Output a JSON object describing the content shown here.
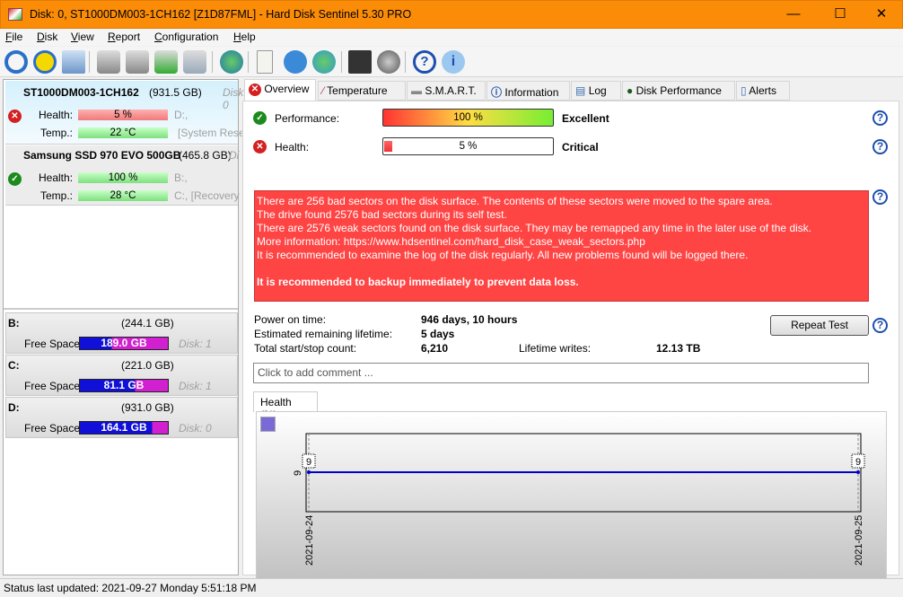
{
  "window": {
    "title": "Disk: 0, ST1000DM003-1CH162 [Z1D87FML]  -  Hard Disk Sentinel 5.30 PRO",
    "minimize": "—",
    "maximize": "☐",
    "close": "✕"
  },
  "menu": [
    "File",
    "Disk",
    "View",
    "Report",
    "Configuration",
    "Help"
  ],
  "toolbar_icons": [
    "refresh-icon",
    "alert-refresh-icon",
    "disk-view-icon",
    "disk-tools-icon",
    "disk-timer-icon",
    "disk-ok-icon",
    "disk-search-icon",
    "web-disk-icon",
    "report-icon",
    "send-report-icon",
    "network-icon",
    "settings-icon",
    "sound-icon",
    "help-icon",
    "info-icon"
  ],
  "disks": [
    {
      "name": "ST1000DM003-1CH162",
      "size": "(931.5 GB)",
      "disk": "Disk: 0",
      "health_label": "Health:",
      "health": "5 %",
      "health_value": 5,
      "temp_label": "Temp.:",
      "temp": "22 °C",
      "vol1": "D:,",
      "vol2": "[System Rese",
      "status": "critical"
    },
    {
      "name": "Samsung SSD 970 EVO 500GB",
      "size": "(465.8 GB)",
      "disk": "Di",
      "health_label": "Health:",
      "health": "100 %",
      "health_value": 100,
      "temp_label": "Temp.:",
      "temp": "28 °C",
      "vol1": "B:,",
      "vol2": "C:,  [Recovery",
      "status": "ok"
    }
  ],
  "volumes": [
    {
      "letter": "B:",
      "size": "(244.1 GB)",
      "free_label": "Free Space",
      "free": "189.0 GB",
      "used_pct": 36,
      "disk": "Disk: 1"
    },
    {
      "letter": "C:",
      "size": "(221.0 GB)",
      "free_label": "Free Space",
      "free": "81.1 GB",
      "used_pct": 63,
      "disk": "Disk: 1"
    },
    {
      "letter": "D:",
      "size": "(931.0 GB)",
      "free_label": "Free Space",
      "free": "164.1 GB",
      "used_pct": 82,
      "disk": "Disk: 0"
    }
  ],
  "tabs": [
    "Overview",
    "Temperature",
    "S.M.A.R.T.",
    "Information",
    "Log",
    "Disk Performance",
    "Alerts"
  ],
  "overview": {
    "performance_label": "Performance:",
    "performance": "100 %",
    "performance_value": 100,
    "performance_rating": "Excellent",
    "health_label": "Health:",
    "health": "5 %",
    "health_value": 5,
    "health_rating": "Critical",
    "message_lines": [
      "There are 256 bad sectors on the disk surface. The contents of these sectors were moved to the spare area.",
      "The drive found 2576 bad sectors during its self test.",
      "There are 2576 weak sectors found on the disk surface. They may be remapped any time in the later use of the disk.",
      "More information: https://www.hdsentinel.com/hard_disk_case_weak_sectors.php",
      "It is recommended to examine the log of the disk regularly. All new problems found will be logged there."
    ],
    "message_bold": "It is recommended to backup immediately to prevent data loss.",
    "power_on_label": "Power on time:",
    "power_on": "946 days, 10 hours",
    "lifetime_label": "Estimated remaining lifetime:",
    "lifetime": "5 days",
    "startstop_label": "Total start/stop count:",
    "startstop": "6,210",
    "writes_label": "Lifetime writes:",
    "writes": "12.13 TB",
    "repeat_test": "Repeat Test",
    "comment_placeholder": "Click to add comment ...",
    "chart_tab": "Health (%)"
  },
  "chart_data": {
    "type": "line",
    "x": [
      "2021-09-24",
      "2021-09-25"
    ],
    "series": [
      {
        "values": [
          9,
          9
        ]
      }
    ],
    "yticks": [
      "9"
    ],
    "data_labels": [
      "9",
      "9"
    ],
    "line_color": "#0000c8"
  },
  "status": "Status last updated: 2021-09-27 Monday 5:51:18 PM"
}
